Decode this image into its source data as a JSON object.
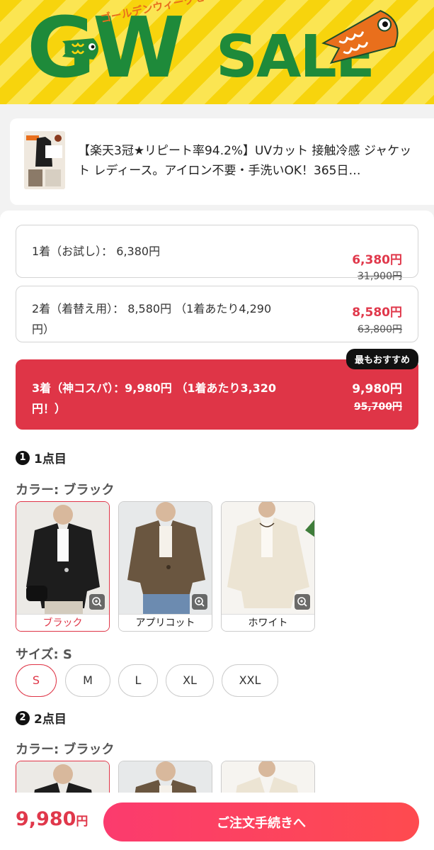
{
  "banner": {
    "title_left": "GW",
    "title_right": "SALE",
    "subtitle": "ゴールデンウィークセール"
  },
  "product": {
    "title": "【楽天3冠★リピート率94.2%】UVカット 接触冷感 ジャケット レディース。アイロン不要・手洗いOK！365日…"
  },
  "options": [
    {
      "label": "1着（お試し）： 6,380円",
      "price": "6,380円",
      "original": "31,900円"
    },
    {
      "label": "2着（着替え用）： 8,580円 （1着あたり4,290円）",
      "price": "8,580円",
      "original": "63,800円"
    },
    {
      "label": "3着（神コスパ）：9,980円 （1着あたり3,320円！）",
      "price": "9,980円",
      "original": "95,700円",
      "badge": "最もおすすめ",
      "selected": true
    }
  ],
  "item1": {
    "heading_num": "1",
    "heading": "1点目",
    "color_label": "カラー: ブラック",
    "colors": [
      "ブラック",
      "アプリコット",
      "ホワイト"
    ],
    "size_label": "サイズ: S",
    "sizes": [
      "S",
      "M",
      "L",
      "XL",
      "XXL"
    ]
  },
  "item2": {
    "heading_num": "2",
    "heading": "2点目",
    "color_label": "カラー: ブラック"
  },
  "footer": {
    "total_value": "9,980",
    "total_unit": "円",
    "cta": "ご注文手続きへ"
  },
  "colors": {
    "accent": "#df3547",
    "banner_green": "#1e8a3a",
    "banner_yellow": "#f7d40d"
  }
}
